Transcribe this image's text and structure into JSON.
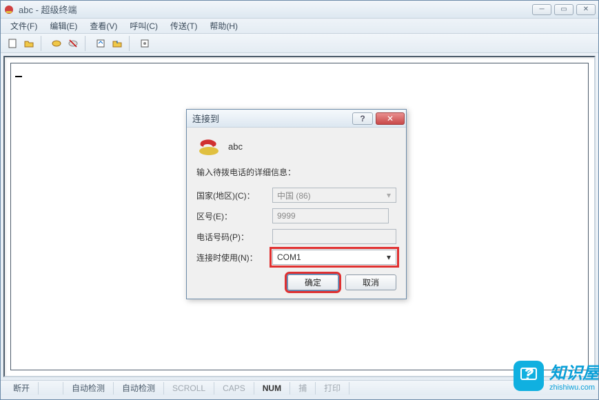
{
  "window": {
    "title": "abc - 超级终端"
  },
  "menu": {
    "file": "文件(F)",
    "edit": "编辑(E)",
    "view": "查看(V)",
    "call": "呼叫(C)",
    "transfer": "传送(T)",
    "help": "帮助(H)"
  },
  "dialog": {
    "title": "连接到",
    "caption": "abc",
    "prompt": "输入待拨电话的详细信息：",
    "labels": {
      "country": "国家(地区)(C)：",
      "area": "区号(E)：",
      "phone": "电话号码(P)：",
      "connect": "连接时使用(N)："
    },
    "values": {
      "country": "中国 (86)",
      "area": "9999",
      "phone": "",
      "connect": "COM1"
    },
    "buttons": {
      "ok": "确定",
      "cancel": "取消"
    }
  },
  "status": {
    "disconnected": "断开",
    "autodetect1": "自动检测",
    "autodetect2": "自动检测",
    "scroll": "SCROLL",
    "caps": "CAPS",
    "num": "NUM",
    "capture": "捕",
    "print": "打印"
  },
  "watermark": {
    "brand": "知识屋",
    "domain": "zhishiwu.com"
  }
}
